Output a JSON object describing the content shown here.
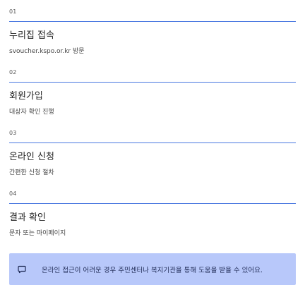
{
  "steps": [
    {
      "number": "01",
      "title": "누리집 접속",
      "description": "svoucher.kspo.or.kr 방문"
    },
    {
      "number": "02",
      "title": "회원가입",
      "description": "대상자 확인 진행"
    },
    {
      "number": "03",
      "title": "온라인 신청",
      "description": "간편한 신청 절차"
    },
    {
      "number": "04",
      "title": "결과 확인",
      "description": "문자 또는 마이페이지"
    }
  ],
  "notice": {
    "icon": "chat-bubble-icon",
    "text": "온라인 접근이 어려운 경우 주민센터나 복지기관을 통해 도움을 받을 수 있어요."
  },
  "colors": {
    "accent_line": "#4a78e0",
    "notice_background": "#b8c8fa",
    "notice_text": "#1f2a55"
  }
}
